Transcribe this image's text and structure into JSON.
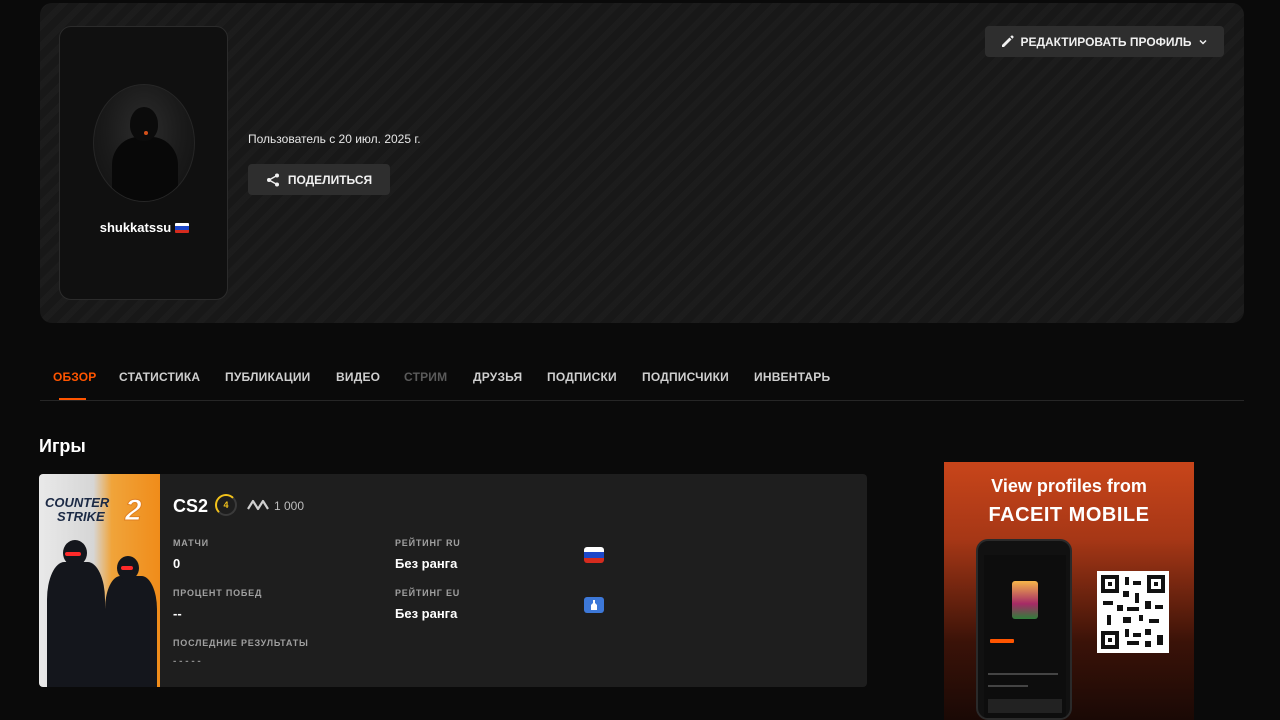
{
  "profile": {
    "username": "shukkatssu",
    "country_flag": "ru",
    "member_since": "Пользователь с 20 июл. 2025 г.",
    "share_label": "ПОДЕЛИТЬСЯ",
    "edit_label": "РЕДАКТИРОВАТЬ ПРОФИЛЬ"
  },
  "tabs": [
    {
      "label": "ОБЗОР",
      "state": "active"
    },
    {
      "label": "СТАТИСТИКА",
      "state": "normal"
    },
    {
      "label": "ПУБЛИКАЦИИ",
      "state": "normal"
    },
    {
      "label": "ВИДЕО",
      "state": "normal"
    },
    {
      "label": "СТРИМ",
      "state": "disabled"
    },
    {
      "label": "ДРУЗЬЯ",
      "state": "normal"
    },
    {
      "label": "ПОДПИСКИ",
      "state": "normal"
    },
    {
      "label": "ПОДПИСЧИКИ",
      "state": "normal"
    },
    {
      "label": "ИНВЕНТАРЬ",
      "state": "normal"
    }
  ],
  "games_section": {
    "title": "Игры",
    "game": {
      "cover_line1": "COUNTER",
      "cover_line2": "STRIKE",
      "cover_num": "2",
      "name": "CS2",
      "level": "4",
      "elo": "1 000",
      "stats": {
        "matches_label": "МАТЧИ",
        "matches_value": "0",
        "winrate_label": "ПРОЦЕНТ ПОБЕД",
        "winrate_value": "--",
        "recent_label": "ПОСЛЕДНИЕ РЕЗУЛЬТАТЫ",
        "recent_value": "- - - - -",
        "rating_ru_label": "РЕЙТИНГ RU",
        "rating_ru_value": "Без ранга",
        "rating_eu_label": "РЕЙТИНГ EU",
        "rating_eu_value": "Без ранга"
      }
    }
  },
  "ad": {
    "line1": "View profiles from",
    "line2": "FACEIT MOBILE"
  },
  "colors": {
    "accent": "#ff5500",
    "level_yellow": "#f2c21b"
  }
}
